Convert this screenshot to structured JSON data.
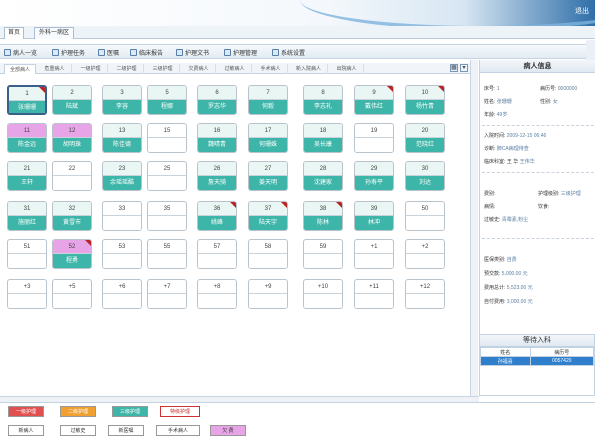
{
  "header": {
    "user_label": "退出"
  },
  "tabs": [
    {
      "label": "首页"
    },
    {
      "label": "外科一病区"
    }
  ],
  "toolbar": [
    {
      "label": "病人一览"
    },
    {
      "label": "护理任务"
    },
    {
      "label": "医嘱"
    },
    {
      "label": "临床报告"
    },
    {
      "label": "护理文书"
    },
    {
      "label": "护理管理"
    },
    {
      "label": "系统设置"
    }
  ],
  "ward_tabs": [
    {
      "label": "全部病人"
    },
    {
      "label": "危重病人"
    },
    {
      "label": "一级护理"
    },
    {
      "label": "二级护理"
    },
    {
      "label": "三级护理"
    },
    {
      "label": "欠费病人"
    },
    {
      "label": "过敏病人"
    },
    {
      "label": "手术病人"
    },
    {
      "label": "新入院病人"
    },
    {
      "label": "出院病人"
    }
  ],
  "beds": [
    {
      "num": "1",
      "name": "张珊珊",
      "style": "teal",
      "selected": true,
      "corner": true
    },
    {
      "num": "2",
      "name": "陆斌",
      "style": "teal"
    },
    {
      "num": "3",
      "name": "李容",
      "style": "teal"
    },
    {
      "num": "5",
      "name": "程娜",
      "style": "teal"
    },
    {
      "num": "6",
      "name": "罗志华",
      "style": "teal"
    },
    {
      "num": "7",
      "name": "何毅",
      "style": "teal"
    },
    {
      "num": "8",
      "name": "李志礼",
      "style": "teal"
    },
    {
      "num": "9",
      "name": "戴伟红",
      "style": "teal",
      "corner": true
    },
    {
      "num": "10",
      "name": "杨竹青",
      "style": "teal",
      "corner": true
    },
    {
      "num": "11",
      "name": "陈金远",
      "style": "pink"
    },
    {
      "num": "12",
      "name": "胡明珠",
      "style": "pink"
    },
    {
      "num": "13",
      "name": "陈佳德",
      "style": "teal"
    },
    {
      "num": "15",
      "name": "",
      "style": "empty"
    },
    {
      "num": "16",
      "name": "魏晴青",
      "style": "teal"
    },
    {
      "num": "17",
      "name": "何珊姝",
      "style": "teal"
    },
    {
      "num": "18",
      "name": "吴长康",
      "style": "teal"
    },
    {
      "num": "19",
      "name": "",
      "style": "empty"
    },
    {
      "num": "20",
      "name": "范晓红",
      "style": "teal"
    },
    {
      "num": "21",
      "name": "王轩",
      "style": "teal"
    },
    {
      "num": "22",
      "name": "",
      "style": "empty"
    },
    {
      "num": "23",
      "name": "余瑶瑶酷",
      "style": "teal"
    },
    {
      "num": "25",
      "name": "",
      "style": "empty"
    },
    {
      "num": "26",
      "name": "詹天骑",
      "style": "teal"
    },
    {
      "num": "27",
      "name": "姜天明",
      "style": "teal"
    },
    {
      "num": "28",
      "name": "沈建家",
      "style": "teal"
    },
    {
      "num": "29",
      "name": "孙寿平",
      "style": "teal"
    },
    {
      "num": "30",
      "name": "刘达",
      "style": "teal"
    },
    {
      "num": "31",
      "name": "施丽红",
      "style": "teal"
    },
    {
      "num": "32",
      "name": "黄雪市",
      "style": "teal"
    },
    {
      "num": "33",
      "name": "",
      "style": "empty"
    },
    {
      "num": "35",
      "name": "",
      "style": "empty"
    },
    {
      "num": "36",
      "name": "姚峰",
      "style": "teal",
      "corner": true
    },
    {
      "num": "37",
      "name": "陆天宇",
      "style": "teal",
      "corner": true
    },
    {
      "num": "38",
      "name": "陈林",
      "style": "teal",
      "corner": true
    },
    {
      "num": "39",
      "name": "林冲",
      "style": "teal"
    },
    {
      "num": "50",
      "name": "",
      "style": "empty"
    },
    {
      "num": "51",
      "name": "",
      "style": "empty"
    },
    {
      "num": "52",
      "name": "程勇",
      "style": "pink2",
      "corner": true
    },
    {
      "num": "53",
      "name": "",
      "style": "empty"
    },
    {
      "num": "55",
      "name": "",
      "style": "empty"
    },
    {
      "num": "57",
      "name": "",
      "style": "empty"
    },
    {
      "num": "58",
      "name": "",
      "style": "empty"
    },
    {
      "num": "59",
      "name": "",
      "style": "empty"
    },
    {
      "num": "+1",
      "name": "",
      "style": "empty"
    },
    {
      "num": "+2",
      "name": "",
      "style": "empty"
    },
    {
      "num": "+3",
      "name": "",
      "style": "empty"
    },
    {
      "num": "+5",
      "name": "",
      "style": "empty"
    },
    {
      "num": "+6",
      "name": "",
      "style": "empty"
    },
    {
      "num": "+7",
      "name": "",
      "style": "empty"
    },
    {
      "num": "+8",
      "name": "",
      "style": "empty"
    },
    {
      "num": "+9",
      "name": "",
      "style": "empty"
    },
    {
      "num": "+10",
      "name": "",
      "style": "empty"
    },
    {
      "num": "+11",
      "name": "",
      "style": "empty"
    },
    {
      "num": "+12",
      "name": "",
      "style": "empty"
    }
  ],
  "patient_info": {
    "title": "病人信息",
    "bed_label": "床号:",
    "bed_value": "1",
    "case_label": "病历号:",
    "case_value": "0000000",
    "name_label": "姓名:",
    "name_value": "张珊珊",
    "sex_label": "性别:",
    "sex_value": "女",
    "age_label": "年龄:",
    "age_value": "49岁",
    "admit_label": "入院时间:",
    "admit_value": "2009-12-15 06:46",
    "diag_label": "诊断:",
    "diag_value": "肺CA病理待查",
    "dept_label": "临床科室:",
    "dept_value": "王 华",
    "doctor_value": "王伟华",
    "cost_label": "费别:",
    "cost_value": "",
    "nurse_level_label": "护理级别:",
    "nurse_level_value": "三级护理",
    "condition_label": "病情:",
    "condition_value": "",
    "diet_label": "饮食:",
    "diet_value": "",
    "allergy_label": "过敏史:",
    "allergy_value": "青霉素,粉尘",
    "insurance_label": "医保类别:",
    "insurance_value": "自费",
    "prepay_label": "预交款:",
    "prepay_value": "5,000.00 元",
    "total_label": "费用总计:",
    "total_value": "5,523.00 元",
    "balance_label": "自付费用:",
    "balance_value": "3,000.00 元"
  },
  "waiting": {
    "title": "等待入科",
    "col_name": "姓名",
    "col_case": "病历号",
    "rows": [
      {
        "name": "孙福喜",
        "case": "0057420"
      }
    ]
  },
  "legend": [
    {
      "label": "一级护理",
      "color": "#e05050"
    },
    {
      "label": "二级护理",
      "color": "#f0a030"
    },
    {
      "label": "三级护理",
      "color": "#3db5a8"
    },
    {
      "label": "特级护理",
      "color": "#ffffff"
    }
  ],
  "legend2": [
    {
      "label": "新病人"
    },
    {
      "label": "过敏史"
    },
    {
      "label": "新医嘱"
    },
    {
      "label": "手术病人"
    },
    {
      "label": "欠 费"
    }
  ]
}
